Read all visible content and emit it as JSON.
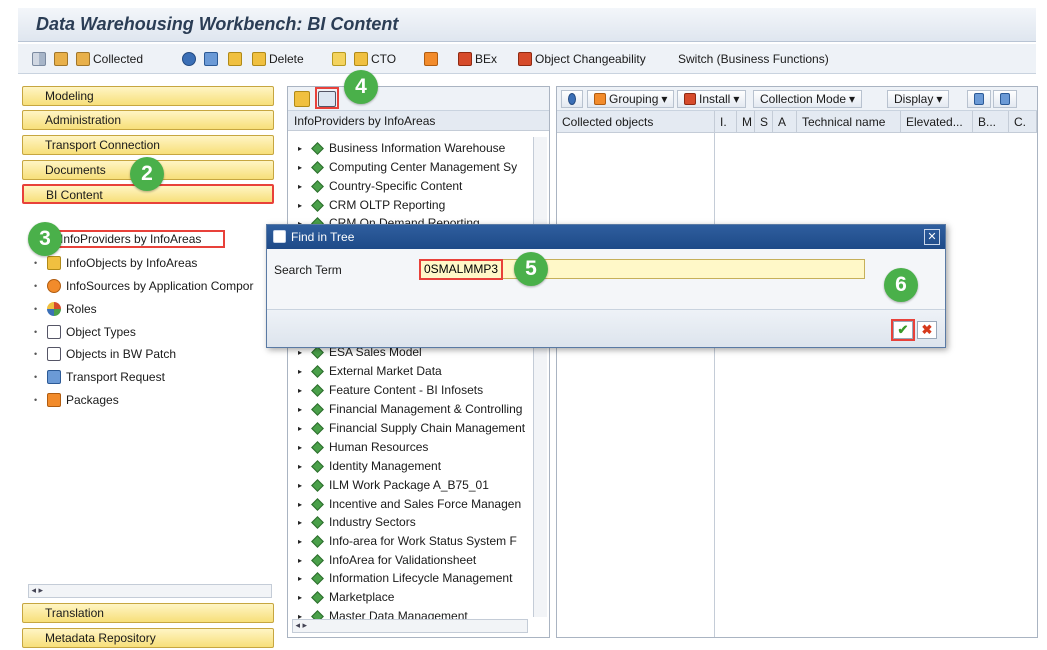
{
  "window": {
    "title": "Data Warehousing Workbench: BI Content"
  },
  "toolbar": {
    "collected": "Collected",
    "delete": "Delete",
    "cto": "CTO",
    "bex": "BEx",
    "object_changeability": "Object Changeability",
    "switch": "Switch (Business Functions)"
  },
  "left_nav": {
    "buttons": [
      "Modeling",
      "Administration",
      "Transport Connection",
      "Documents",
      "BI Content"
    ],
    "tree": [
      "InfoProviders by InfoAreas",
      "InfoObjects by InfoAreas",
      "InfoSources by Application Compor",
      "Roles",
      "Object Types",
      "Objects in BW Patch",
      "Transport Request",
      "Packages"
    ],
    "bottom_buttons": [
      "Translation",
      "Metadata Repository"
    ]
  },
  "middle": {
    "header": "InfoProviders by InfoAreas",
    "tree": [
      "Business Information Warehouse",
      "Computing Center Management Sy",
      "Country-Specific Content",
      "CRM OLTP Reporting",
      "CRM On Demand Reporting",
      "ESA Sales Model",
      "External Market Data",
      "Feature Content - BI Infosets",
      "Financial Management & Controlling",
      "Financial Supply Chain Management",
      "Human Resources",
      "Identity Management",
      "ILM Work Package A_B75_01",
      "Incentive and Sales Force Managen",
      "Industry Sectors",
      "Info-area for Work Status System F",
      "InfoArea for Validationsheet",
      "Information Lifecycle Management",
      "Marketplace",
      "Master Data Management"
    ]
  },
  "right": {
    "toolbar": {
      "grouping": "Grouping",
      "install": "Install",
      "collection_mode": "Collection Mode",
      "display": "Display"
    },
    "columns": [
      "Collected objects",
      "I.",
      "M",
      "S",
      "A",
      "Technical name",
      "Elevated...",
      "B...",
      "C."
    ]
  },
  "dialog": {
    "title": "Find in Tree",
    "search_label": "Search Term",
    "search_value": "0SMALMMP3",
    "ok": "✔",
    "cancel": "✖"
  },
  "steps": [
    "2",
    "3",
    "4",
    "5",
    "6"
  ]
}
